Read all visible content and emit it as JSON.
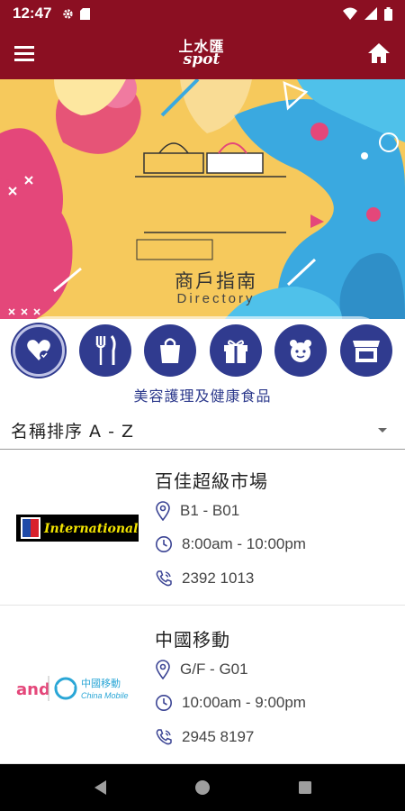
{
  "status_bar": {
    "time": "12:47"
  },
  "app_bar": {
    "logo_top": "上水匯",
    "logo_bottom": "spot"
  },
  "banner": {
    "title_zh": "商戶指南",
    "title_en": "Directory",
    "search_placeholder": ""
  },
  "categories": {
    "items": [
      {
        "icon": "beauty-health-icon",
        "active": true
      },
      {
        "icon": "dining-icon",
        "active": false
      },
      {
        "icon": "shopping-bag-icon",
        "active": false
      },
      {
        "icon": "gift-icon",
        "active": false
      },
      {
        "icon": "kids-toys-icon",
        "active": false
      },
      {
        "icon": "shop-front-icon",
        "active": false
      }
    ],
    "selected_label": "美容護理及健康食品"
  },
  "sort": {
    "label": "名稱排序 A - Z"
  },
  "shops": [
    {
      "name": "百佳超級市場",
      "location": "B1 - B01",
      "hours": "8:00am - 10:00pm",
      "phone": "2392 1013",
      "logo_text": "International"
    },
    {
      "name": "中國移動",
      "location": "G/F - G01",
      "hours": "10:00am - 9:00pm",
      "phone": "2945 8197",
      "logo_text_a": "and",
      "logo_text_zh": "中國移動",
      "logo_text_en": "China Mobile"
    }
  ],
  "colors": {
    "brand": "#8b0f22",
    "category": "#303b8f",
    "banner_yellow": "#f6c95c",
    "banner_pink": "#e4477a",
    "banner_blue": "#3aa9e0"
  }
}
